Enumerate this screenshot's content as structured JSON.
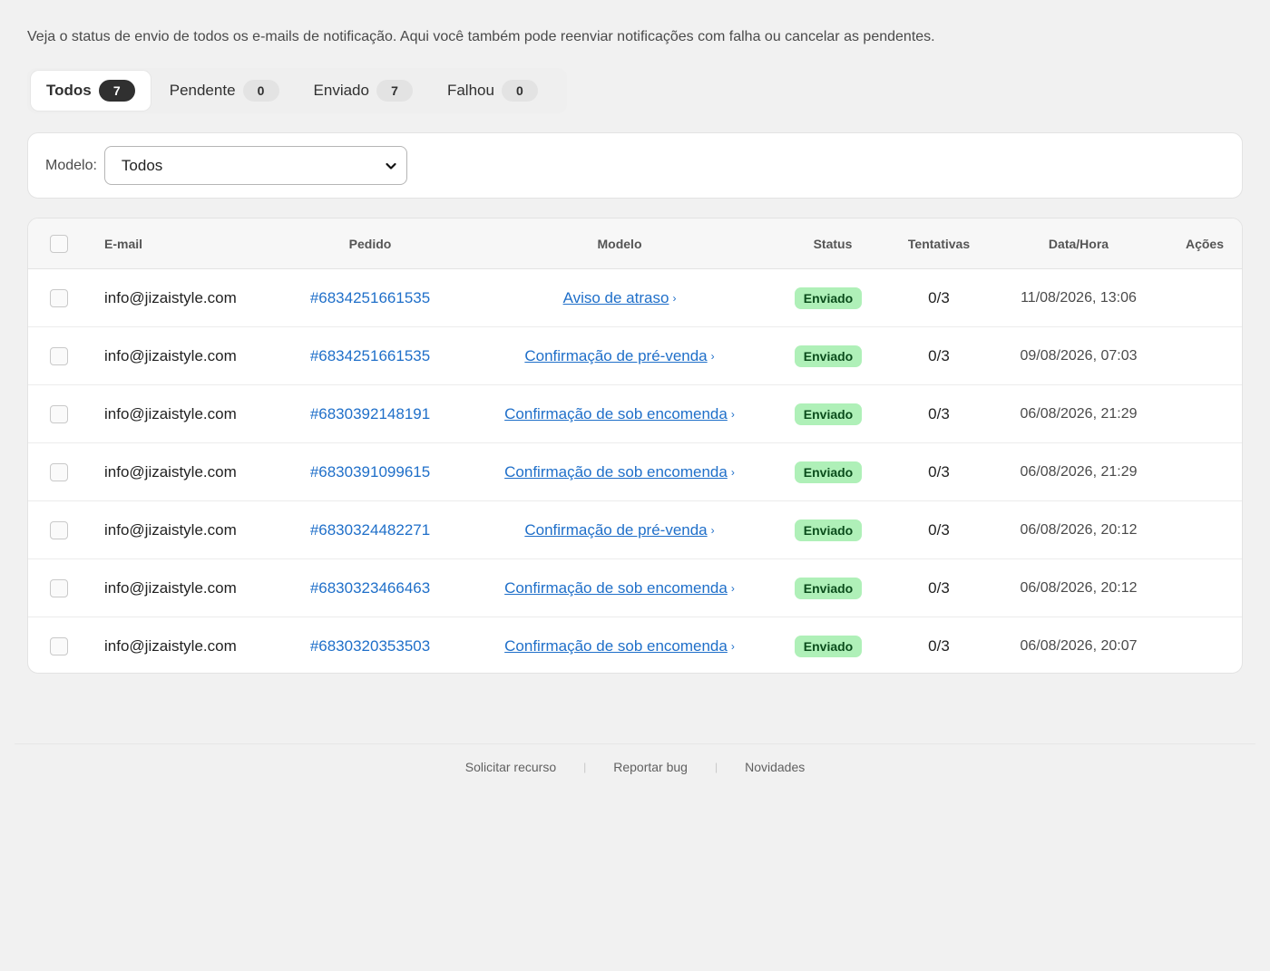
{
  "intro": "Veja o status de envio de todos os e-mails de notificação. Aqui você também pode reenviar notificações com falha ou cancelar as pendentes.",
  "tabs": [
    {
      "label": "Todos",
      "count": "7",
      "active": true
    },
    {
      "label": "Pendente",
      "count": "0",
      "active": false
    },
    {
      "label": "Enviado",
      "count": "7",
      "active": false
    },
    {
      "label": "Falhou",
      "count": "0",
      "active": false
    }
  ],
  "filter": {
    "label": "Modelo:",
    "selected": "Todos"
  },
  "table": {
    "headers": {
      "email": "E-mail",
      "order": "Pedido",
      "model": "Modelo",
      "status": "Status",
      "tries": "Tentativas",
      "date": "Data/Hora",
      "actions": "Ações"
    },
    "rows": [
      {
        "email": "info@jizaistyle.com",
        "order": "#6834251661535",
        "model": "Aviso de atraso",
        "status": "Enviado",
        "tries": "0/3",
        "date": "11/08/2026, 13:06"
      },
      {
        "email": "info@jizaistyle.com",
        "order": "#6834251661535",
        "model": "Confirmação de pré-venda",
        "status": "Enviado",
        "tries": "0/3",
        "date": "09/08/2026, 07:03"
      },
      {
        "email": "info@jizaistyle.com",
        "order": "#6830392148191",
        "model": "Confirmação de sob encomenda",
        "status": "Enviado",
        "tries": "0/3",
        "date": "06/08/2026, 21:29"
      },
      {
        "email": "info@jizaistyle.com",
        "order": "#6830391099615",
        "model": "Confirmação de sob encomenda",
        "status": "Enviado",
        "tries": "0/3",
        "date": "06/08/2026, 21:29"
      },
      {
        "email": "info@jizaistyle.com",
        "order": "#6830324482271",
        "model": "Confirmação de pré-venda",
        "status": "Enviado",
        "tries": "0/3",
        "date": "06/08/2026, 20:12"
      },
      {
        "email": "info@jizaistyle.com",
        "order": "#6830323466463",
        "model": "Confirmação de sob encomenda",
        "status": "Enviado",
        "tries": "0/3",
        "date": "06/08/2026, 20:12"
      },
      {
        "email": "info@jizaistyle.com",
        "order": "#6830320353503",
        "model": "Confirmação de sob encomenda",
        "status": "Enviado",
        "tries": "0/3",
        "date": "06/08/2026, 20:07"
      }
    ]
  },
  "footer": {
    "links": [
      "Solicitar recurso",
      "Reportar bug",
      "Novidades"
    ]
  },
  "icons": {
    "model_arrow": "›",
    "select_chevron": "chevron-down-icon"
  },
  "colors": {
    "link": "#1f6fc9",
    "badge_bg": "#aff0b8",
    "badge_text": "#0b4d1c",
    "active_count": "#303030"
  }
}
